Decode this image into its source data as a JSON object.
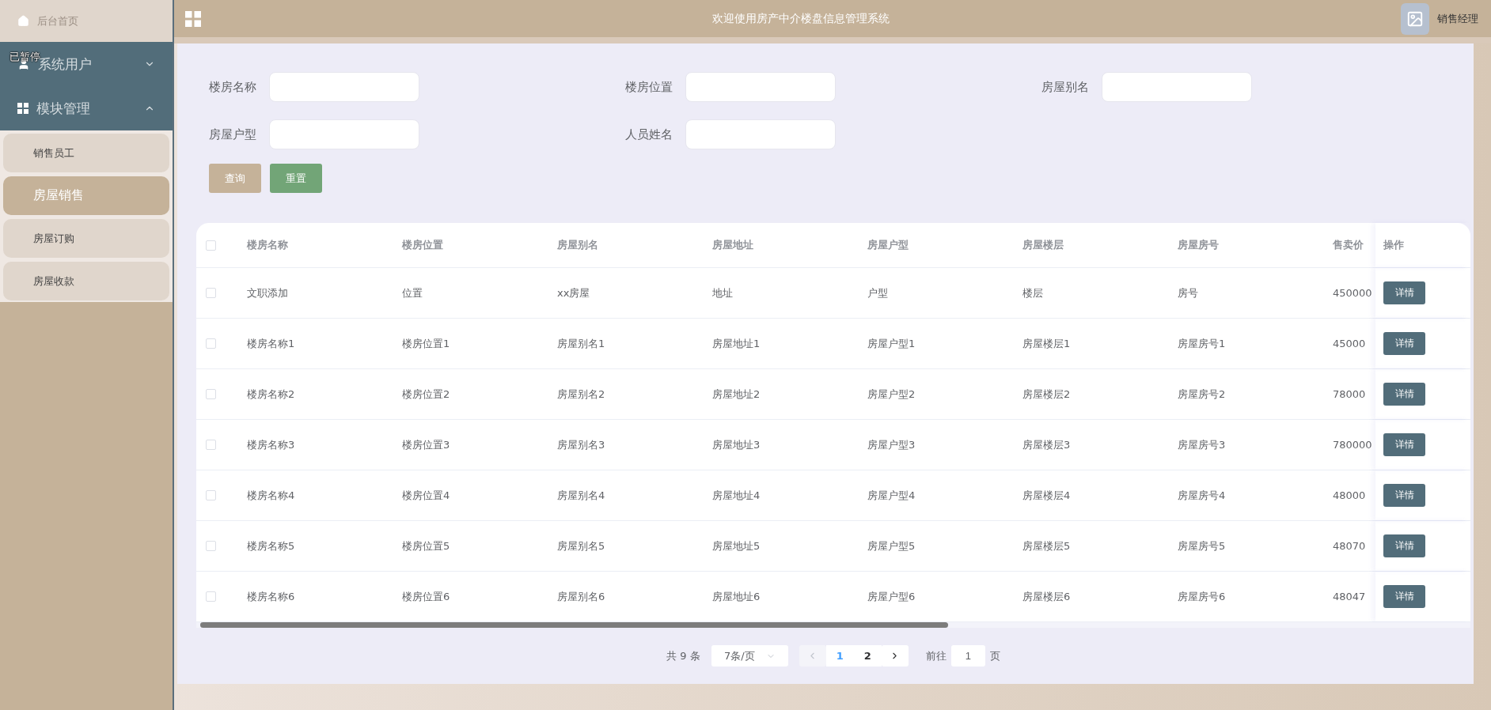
{
  "header": {
    "title": "欢迎使用房产中介楼盘信息管理系统",
    "user": "销售经理"
  },
  "sidebar": {
    "home": {
      "label": "后台首页"
    },
    "overlay_label": "已暂停",
    "groups": [
      {
        "label": "系统用户",
        "kind": "user",
        "expanded": false
      },
      {
        "label": "模块管理",
        "kind": "grid",
        "expanded": true,
        "children": [
          {
            "label": "销售员工",
            "selected": false
          },
          {
            "label": "房屋销售",
            "selected": true
          },
          {
            "label": "房屋订购",
            "selected": false
          },
          {
            "label": "房屋收款",
            "selected": false
          }
        ]
      }
    ]
  },
  "search": {
    "fields": [
      {
        "label": "楼房名称"
      },
      {
        "label": "楼房位置"
      },
      {
        "label": "房屋别名"
      },
      {
        "label": "房屋户型"
      },
      {
        "label": "人员姓名"
      }
    ],
    "buttons": [
      {
        "label": "查询",
        "kind": "search"
      },
      {
        "label": "重置",
        "kind": "reset"
      }
    ]
  },
  "table": {
    "columns": [
      "楼房名称",
      "楼房位置",
      "房屋别名",
      "房屋地址",
      "房屋户型",
      "房屋楼层",
      "房屋房号",
      "售卖价"
    ],
    "action_column": "操作",
    "header_checked": false,
    "rows": [
      {
        "checked": false,
        "cells": [
          "文职添加",
          "位置",
          "xx房屋",
          "地址",
          "户型",
          "楼层",
          "房号",
          "450000"
        ],
        "action": "详情"
      },
      {
        "checked": false,
        "cells": [
          "楼房名称1",
          "楼房位置1",
          "房屋别名1",
          "房屋地址1",
          "房屋户型1",
          "房屋楼层1",
          "房屋房号1",
          "45000"
        ],
        "action": "详情"
      },
      {
        "checked": false,
        "cells": [
          "楼房名称2",
          "楼房位置2",
          "房屋别名2",
          "房屋地址2",
          "房屋户型2",
          "房屋楼层2",
          "房屋房号2",
          "78000"
        ],
        "action": "详情"
      },
      {
        "checked": false,
        "cells": [
          "楼房名称3",
          "楼房位置3",
          "房屋别名3",
          "房屋地址3",
          "房屋户型3",
          "房屋楼层3",
          "房屋房号3",
          "780000"
        ],
        "action": "详情"
      },
      {
        "checked": false,
        "cells": [
          "楼房名称4",
          "楼房位置4",
          "房屋别名4",
          "房屋地址4",
          "房屋户型4",
          "房屋楼层4",
          "房屋房号4",
          "48000"
        ],
        "action": "详情"
      },
      {
        "checked": false,
        "cells": [
          "楼房名称5",
          "楼房位置5",
          "房屋别名5",
          "房屋地址5",
          "房屋户型5",
          "房屋楼层5",
          "房屋房号5",
          "48070"
        ],
        "action": "详情"
      },
      {
        "checked": false,
        "cells": [
          "楼房名称6",
          "楼房位置6",
          "房屋别名6",
          "房屋地址6",
          "房屋户型6",
          "房屋楼层6",
          "房屋房号6",
          "48047"
        ],
        "action": "详情"
      }
    ]
  },
  "pagination": {
    "total": "共 9 条",
    "page_size": "7条/页",
    "pages": [
      {
        "label": "1",
        "selected": true
      },
      {
        "label": "2",
        "selected": false
      }
    ],
    "goto_label": "前往",
    "goto_value": "1",
    "goto_suffix": "页"
  }
}
